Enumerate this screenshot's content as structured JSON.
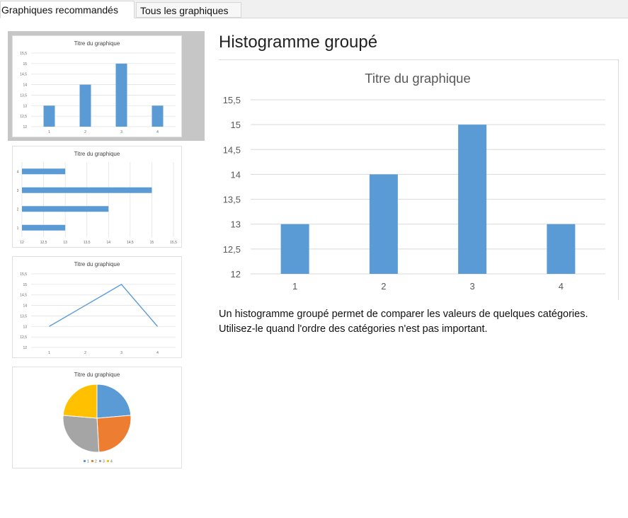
{
  "tabs": [
    {
      "label": "Graphiques recommandés",
      "active": true
    },
    {
      "label": "Tous les graphiques",
      "active": false
    }
  ],
  "thumbnails": [
    {
      "name": "clustered-column",
      "title": "Titre du graphique",
      "selected": true,
      "y_ticks": [
        "12",
        "12,5",
        "13",
        "13,5",
        "14",
        "14,5",
        "15",
        "15,5"
      ],
      "x_ticks": [
        "1",
        "2",
        "3",
        "4"
      ]
    },
    {
      "name": "clustered-bar",
      "title": "Titre du graphique",
      "selected": false,
      "x_ticks": [
        "12",
        "12,5",
        "13",
        "13,5",
        "14",
        "14,5",
        "15",
        "15,5"
      ],
      "y_ticks": [
        "1",
        "2",
        "3",
        "4"
      ]
    },
    {
      "name": "line",
      "title": "Titre du graphique",
      "selected": false,
      "y_ticks": [
        "12",
        "12,5",
        "13",
        "13,5",
        "14",
        "14,5",
        "15",
        "15,5"
      ],
      "x_ticks": [
        "1",
        "2",
        "3",
        "4"
      ]
    },
    {
      "name": "pie",
      "title": "Titre du graphique",
      "selected": false,
      "legend": [
        "1",
        "2",
        "3",
        "4"
      ]
    }
  ],
  "preview": {
    "heading": "Histogramme groupé",
    "description_lines": [
      "Un histogramme groupé permet de comparer les valeurs de quelques catégories.",
      "Utilisez-le quand l'ordre des catégories n'est pas important."
    ]
  },
  "colors": {
    "bar": "#5b9bd5",
    "pie": [
      "#5b9bd5",
      "#ed7d31",
      "#a5a5a5",
      "#ffc000"
    ],
    "grid": "#d9d9d9",
    "axis_text": "#595959"
  },
  "chart_data": {
    "type": "bar",
    "title": "Titre du graphique",
    "categories": [
      "1",
      "2",
      "3",
      "4"
    ],
    "values": [
      13,
      14,
      15,
      13
    ],
    "xlabel": "",
    "ylabel": "",
    "ylim": [
      12,
      15.5
    ],
    "y_ticks": [
      "12",
      "12,5",
      "13",
      "13,5",
      "14",
      "14,5",
      "15",
      "15,5"
    ],
    "grid": true
  }
}
